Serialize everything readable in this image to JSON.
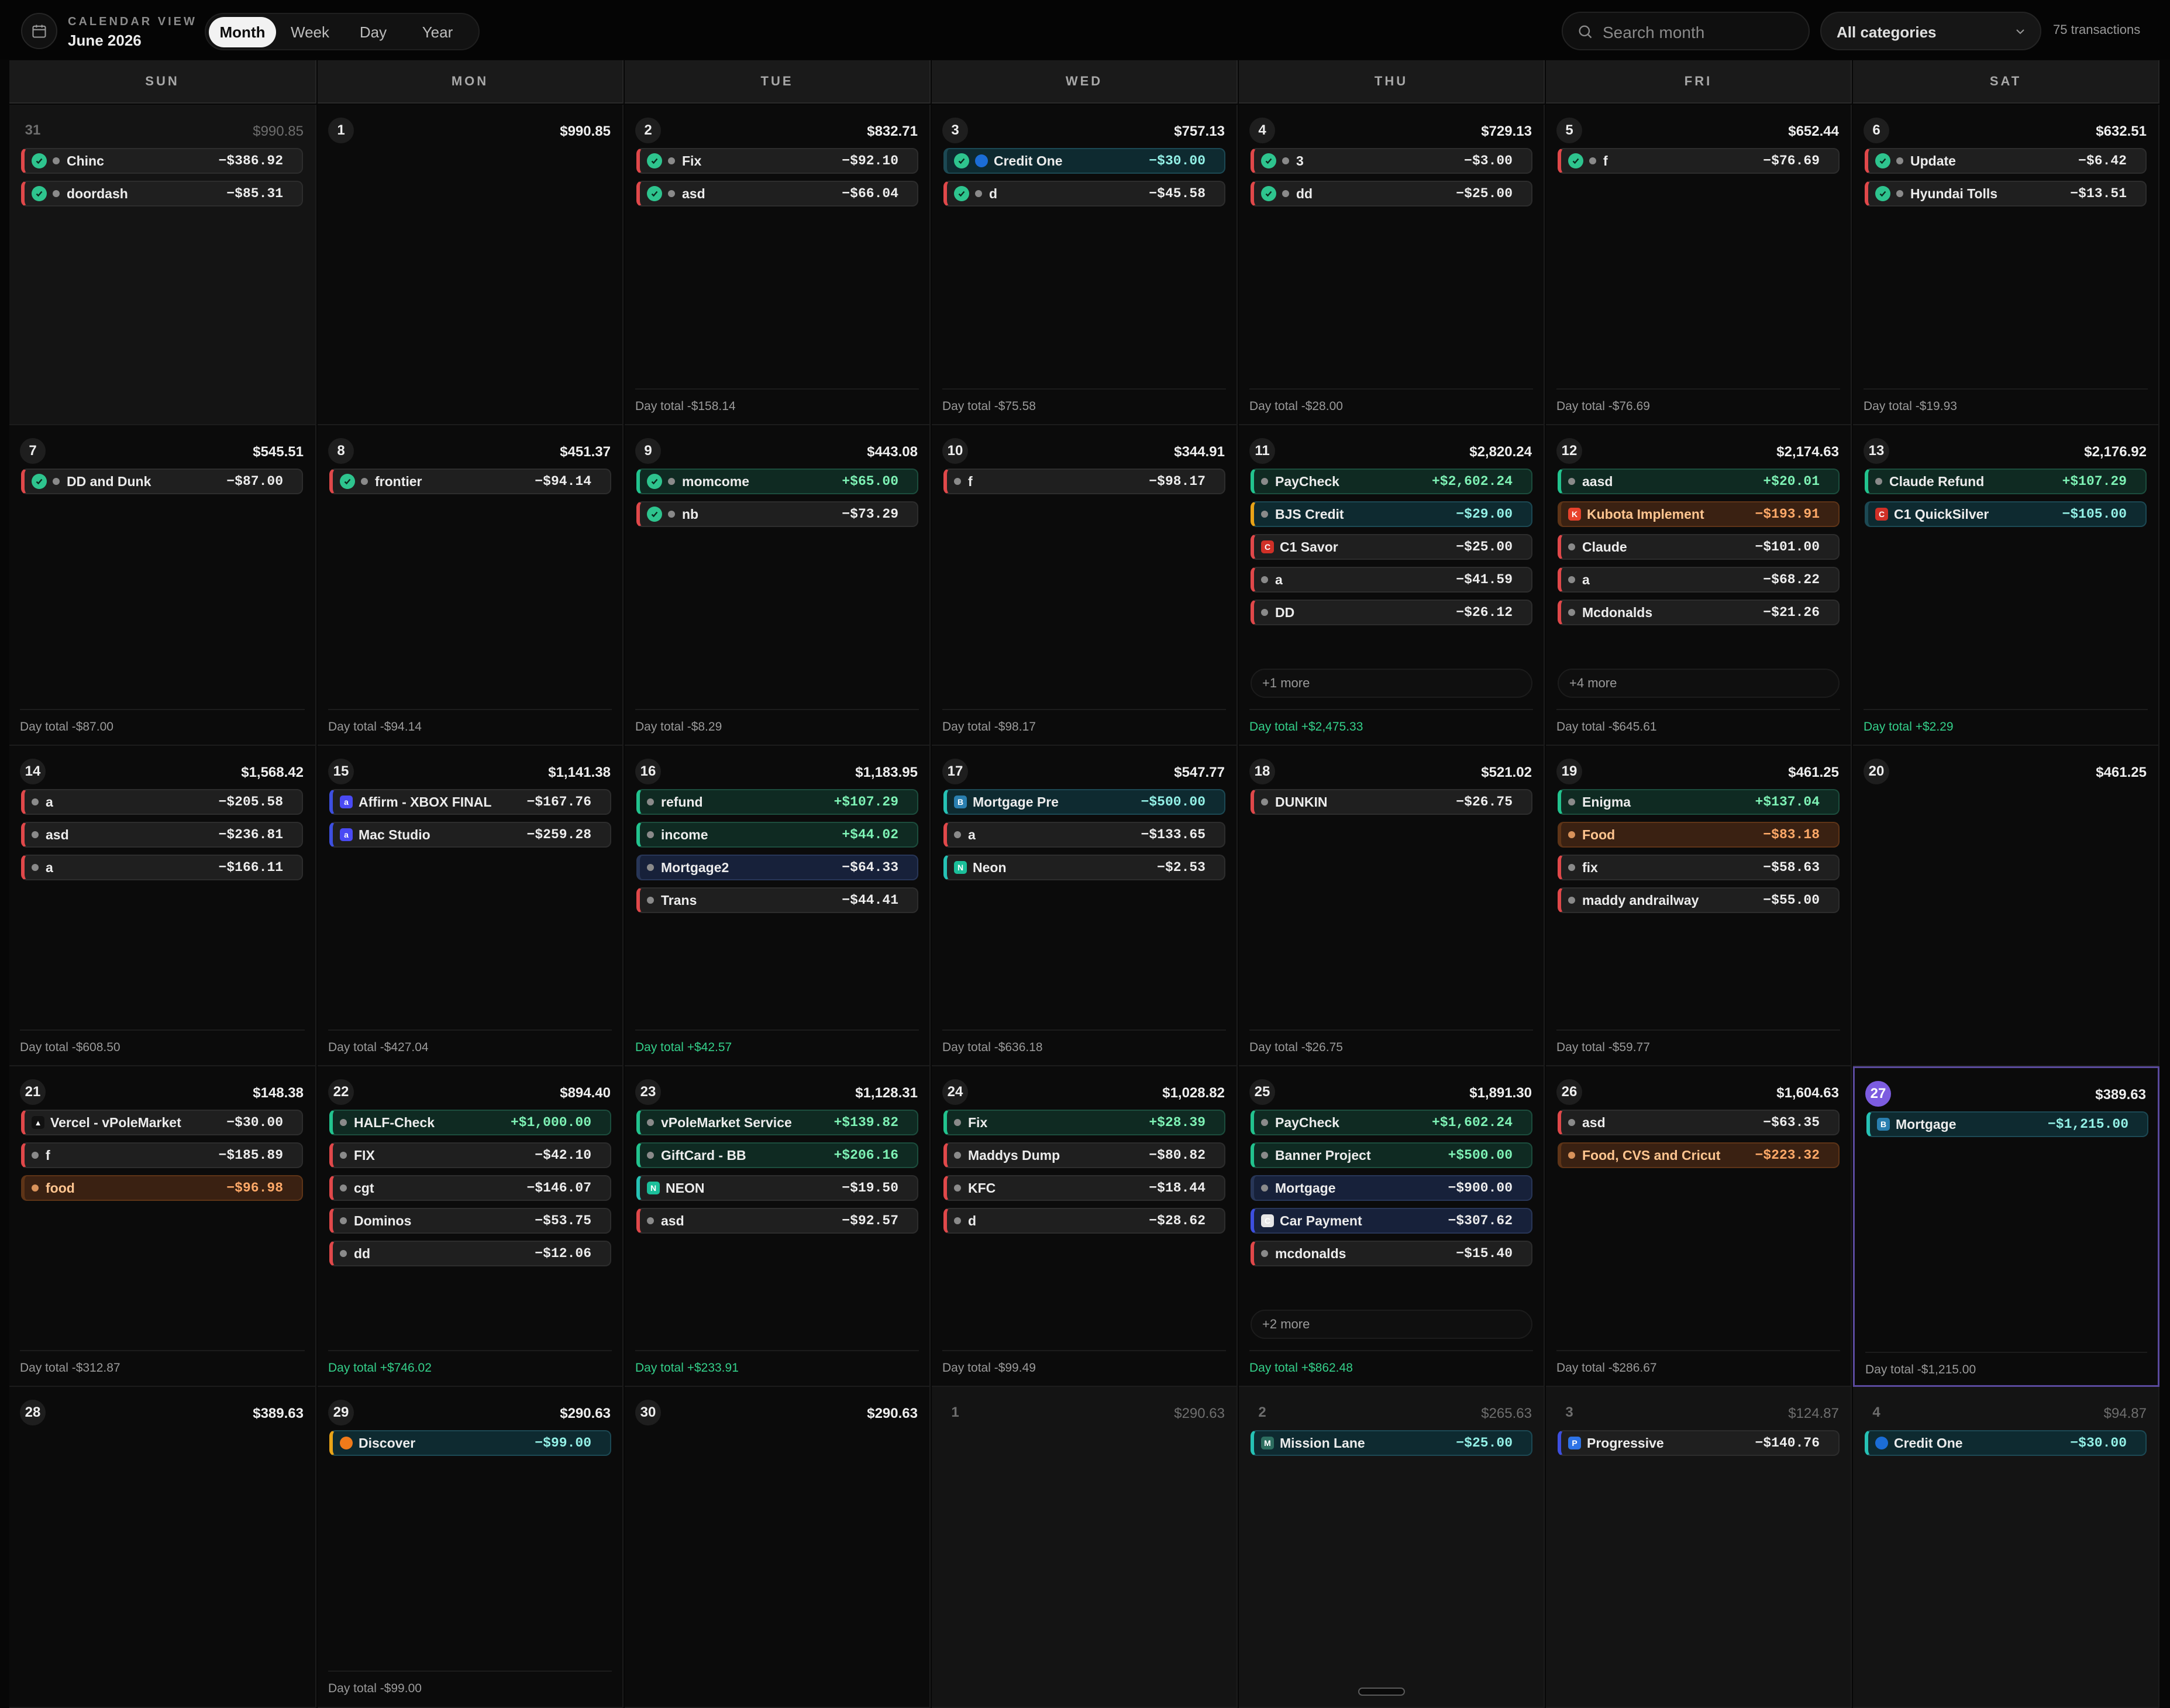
{
  "header": {
    "subtitle": "CALENDAR VIEW",
    "title": "June 2026",
    "view_tabs": [
      "Month",
      "Week",
      "Day",
      "Year"
    ],
    "active_view": "Month",
    "search_placeholder": "Search month",
    "category_filter": "All categories",
    "transaction_count": "75 transactions"
  },
  "colors": {
    "income": "#22c38e",
    "expense": "#e0484a",
    "today": "#7c5ce0",
    "cleared_check": "#2ec48e"
  },
  "weekdays": [
    "SUN",
    "MON",
    "TUE",
    "WED",
    "THU",
    "FRI",
    "SAT"
  ],
  "weeks": [
    [
      {
        "day": "31",
        "balance": "$990.85",
        "dim": true,
        "total": "",
        "tx": [
          {
            "name": "Chinc",
            "amount": "−$386.92",
            "check": true
          },
          {
            "name": "doordash",
            "amount": "−$85.31",
            "check": true
          }
        ]
      },
      {
        "day": "1",
        "balance": "$990.85",
        "total": "",
        "tx": []
      },
      {
        "day": "2",
        "balance": "$832.71",
        "total": "Day total -$158.14",
        "tx": [
          {
            "name": "Fix",
            "amount": "−$92.10",
            "check": true
          },
          {
            "name": "asd",
            "amount": "−$66.04",
            "check": true
          }
        ]
      },
      {
        "day": "3",
        "balance": "$757.13",
        "total": "Day total -$75.58",
        "tx": [
          {
            "name": "Credit One",
            "amount": "−$30.00",
            "check": true,
            "style": "teal",
            "icon": "credit-one-logo",
            "nodot": true
          },
          {
            "name": "d",
            "amount": "−$45.58",
            "check": true
          }
        ]
      },
      {
        "day": "4",
        "balance": "$729.13",
        "total": "Day total -$28.00",
        "tx": [
          {
            "name": "3",
            "amount": "−$3.00",
            "check": true
          },
          {
            "name": "dd",
            "amount": "−$25.00",
            "check": true
          }
        ]
      },
      {
        "day": "5",
        "balance": "$652.44",
        "total": "Day total -$76.69",
        "tx": [
          {
            "name": "f",
            "amount": "−$76.69",
            "check": true
          }
        ]
      },
      {
        "day": "6",
        "balance": "$632.51",
        "total": "Day total -$19.93",
        "tx": [
          {
            "name": "Update",
            "amount": "−$6.42",
            "check": true
          },
          {
            "name": "Hyundai Tolls",
            "amount": "−$13.51",
            "check": true
          }
        ]
      }
    ],
    [
      {
        "day": "7",
        "balance": "$545.51",
        "total": "Day total -$87.00",
        "tx": [
          {
            "name": "DD and Dunk",
            "amount": "−$87.00",
            "check": true
          }
        ]
      },
      {
        "day": "8",
        "balance": "$451.37",
        "total": "Day total -$94.14",
        "tx": [
          {
            "name": "frontier",
            "amount": "−$94.14",
            "check": true
          }
        ]
      },
      {
        "day": "9",
        "balance": "$443.08",
        "total": "Day total -$8.29",
        "tx": [
          {
            "name": "momcome",
            "amount": "+$65.00",
            "check": true,
            "style": "inc"
          },
          {
            "name": "nb",
            "amount": "−$73.29",
            "check": true
          }
        ]
      },
      {
        "day": "10",
        "balance": "$344.91",
        "total": "Day total -$98.17",
        "tx": [
          {
            "name": "f",
            "amount": "−$98.17"
          }
        ]
      },
      {
        "day": "11",
        "balance": "$2,820.24",
        "total": "Day total +$2,475.33",
        "pos": true,
        "more": "+1 more",
        "tx": [
          {
            "name": "PayCheck",
            "amount": "+$2,602.24",
            "style": "inc"
          },
          {
            "name": "BJS Credit",
            "amount": "−$29.00",
            "style": "teal",
            "border": "yellowb"
          },
          {
            "name": "C1 Savor",
            "amount": "−$25.00",
            "icon": "capital-one-logo",
            "nodot": true
          },
          {
            "name": "a",
            "amount": "−$41.59"
          },
          {
            "name": "DD",
            "amount": "−$26.12"
          }
        ]
      },
      {
        "day": "12",
        "balance": "$2,174.63",
        "total": "Day total -$645.61",
        "more": "+4 more",
        "tx": [
          {
            "name": "aasd",
            "amount": "+$20.01",
            "style": "inc"
          },
          {
            "name": "Kubota Implement",
            "amount": "−$193.91",
            "style": "orange",
            "icon": "kubota-logo",
            "nodot": true
          },
          {
            "name": "Claude",
            "amount": "−$101.00"
          },
          {
            "name": "a",
            "amount": "−$68.22"
          },
          {
            "name": "Mcdonalds",
            "amount": "−$21.26"
          }
        ]
      },
      {
        "day": "13",
        "balance": "$2,176.92",
        "total": "Day total +$2.29",
        "pos": true,
        "tx": [
          {
            "name": "Claude Refund",
            "amount": "+$107.29",
            "style": "inc"
          },
          {
            "name": "C1 QuickSilver",
            "amount": "−$105.00",
            "style": "teal",
            "icon": "capital-one-logo",
            "nodot": true
          }
        ]
      }
    ],
    [
      {
        "day": "14",
        "balance": "$1,568.42",
        "total": "Day total -$608.50",
        "tx": [
          {
            "name": "a",
            "amount": "−$205.58"
          },
          {
            "name": "asd",
            "amount": "−$236.81"
          },
          {
            "name": "a",
            "amount": "−$166.11"
          }
        ]
      },
      {
        "day": "15",
        "balance": "$1,141.38",
        "total": "Day total -$427.04",
        "tx": [
          {
            "name": "Affirm - XBOX FINAL",
            "amount": "−$167.76",
            "border": "blueb",
            "icon": "affirm-logo",
            "nodot": true
          },
          {
            "name": "Mac Studio",
            "amount": "−$259.28",
            "border": "blueb",
            "icon": "affirm-logo",
            "nodot": true
          }
        ]
      },
      {
        "day": "16",
        "balance": "$1,183.95",
        "total": "Day total +$42.57",
        "pos": true,
        "tx": [
          {
            "name": "refund",
            "amount": "+$107.29",
            "style": "inc"
          },
          {
            "name": "income",
            "amount": "+$44.02",
            "style": "inc"
          },
          {
            "name": "Mortgage2",
            "amount": "−$64.33",
            "style": "navy"
          },
          {
            "name": "Trans",
            "amount": "−$44.41"
          }
        ]
      },
      {
        "day": "17",
        "balance": "$547.77",
        "total": "Day total -$636.18",
        "tx": [
          {
            "name": "Mortgage Pre",
            "amount": "−$500.00",
            "style": "teal",
            "border": "tealb",
            "icon": "bank-logo",
            "nodot": true
          },
          {
            "name": "a",
            "amount": "−$133.65"
          },
          {
            "name": "Neon",
            "amount": "−$2.53",
            "border": "tealb",
            "icon": "neon-logo",
            "nodot": true
          }
        ]
      },
      {
        "day": "18",
        "balance": "$521.02",
        "total": "Day total -$26.75",
        "tx": [
          {
            "name": "DUNKIN",
            "amount": "−$26.75"
          }
        ]
      },
      {
        "day": "19",
        "balance": "$461.25",
        "total": "Day total -$59.77",
        "tx": [
          {
            "name": "Enigma",
            "amount": "+$137.04",
            "style": "inc"
          },
          {
            "name": "Food",
            "amount": "−$83.18",
            "style": "orange"
          },
          {
            "name": "fix",
            "amount": "−$58.63"
          },
          {
            "name": "maddy andrailway",
            "amount": "−$55.00"
          }
        ]
      },
      {
        "day": "20",
        "balance": "$461.25",
        "total": "",
        "tx": []
      }
    ],
    [
      {
        "day": "21",
        "balance": "$148.38",
        "total": "Day total -$312.87",
        "tx": [
          {
            "name": "Vercel - vPoleMarket",
            "amount": "−$30.00",
            "icon": "vercel-logo",
            "nodot": true
          },
          {
            "name": "f",
            "amount": "−$185.89"
          },
          {
            "name": "food",
            "amount": "−$96.98",
            "style": "orange"
          }
        ]
      },
      {
        "day": "22",
        "balance": "$894.40",
        "total": "Day total +$746.02",
        "pos": true,
        "tx": [
          {
            "name": "HALF-Check",
            "amount": "+$1,000.00",
            "style": "inc"
          },
          {
            "name": "FIX",
            "amount": "−$42.10"
          },
          {
            "name": "cgt",
            "amount": "−$146.07"
          },
          {
            "name": "Dominos",
            "amount": "−$53.75"
          },
          {
            "name": "dd",
            "amount": "−$12.06"
          }
        ]
      },
      {
        "day": "23",
        "balance": "$1,128.31",
        "total": "Day total +$233.91",
        "pos": true,
        "tx": [
          {
            "name": "vPoleMarket Service",
            "amount": "+$139.82",
            "style": "inc"
          },
          {
            "name": "GiftCard - BB",
            "amount": "+$206.16",
            "style": "inc"
          },
          {
            "name": "NEON",
            "amount": "−$19.50",
            "border": "tealb",
            "icon": "neon-logo",
            "nodot": true
          },
          {
            "name": "asd",
            "amount": "−$92.57"
          }
        ]
      },
      {
        "day": "24",
        "balance": "$1,028.82",
        "total": "Day total -$99.49",
        "tx": [
          {
            "name": "Fix",
            "amount": "+$28.39",
            "style": "inc"
          },
          {
            "name": "Maddys Dump",
            "amount": "−$80.82"
          },
          {
            "name": "KFC",
            "amount": "−$18.44"
          },
          {
            "name": "d",
            "amount": "−$28.62"
          }
        ]
      },
      {
        "day": "25",
        "balance": "$1,891.30",
        "total": "Day total +$862.48",
        "pos": true,
        "more": "+2 more",
        "tx": [
          {
            "name": "PayCheck",
            "amount": "+$1,602.24",
            "style": "inc"
          },
          {
            "name": "Banner Project",
            "amount": "+$500.00",
            "style": "inc"
          },
          {
            "name": "Mortgage",
            "amount": "−$900.00",
            "style": "navy"
          },
          {
            "name": "Car Payment",
            "amount": "−$307.62",
            "style": "navy",
            "border": "blueb",
            "icon": "car-logo",
            "nodot": true
          },
          {
            "name": "mcdonalds",
            "amount": "−$15.40"
          }
        ]
      },
      {
        "day": "26",
        "balance": "$1,604.63",
        "total": "Day total -$286.67",
        "tx": [
          {
            "name": "asd",
            "amount": "−$63.35"
          },
          {
            "name": "Food, CVS and Cricut",
            "amount": "−$223.32",
            "style": "orange"
          }
        ]
      },
      {
        "day": "27",
        "balance": "$389.63",
        "today": true,
        "total": "Day total -$1,215.00",
        "tx": [
          {
            "name": "Mortgage",
            "amount": "−$1,215.00",
            "style": "teal",
            "border": "tealb",
            "icon": "bank-logo",
            "nodot": true
          }
        ]
      }
    ],
    [
      {
        "day": "28",
        "balance": "$389.63",
        "total": "",
        "tx": []
      },
      {
        "day": "29",
        "balance": "$290.63",
        "total": "Day total -$99.00",
        "tx": [
          {
            "name": "Discover",
            "amount": "−$99.00",
            "style": "teal",
            "border": "yellowb",
            "icon": "discover-logo",
            "nodot": true
          }
        ]
      },
      {
        "day": "30",
        "balance": "$290.63",
        "total": "",
        "tx": []
      },
      {
        "day": "1",
        "balance": "$290.63",
        "dim": true,
        "total": "",
        "tx": []
      },
      {
        "day": "2",
        "balance": "$265.63",
        "dim": true,
        "total": "",
        "tx": [
          {
            "name": "Mission Lane",
            "amount": "−$25.00",
            "style": "teal",
            "border": "tealb",
            "icon": "mission-lane-logo",
            "nodot": true
          }
        ]
      },
      {
        "day": "3",
        "balance": "$124.87",
        "dim": true,
        "total": "",
        "tx": [
          {
            "name": "Progressive",
            "amount": "−$140.76",
            "border": "blueb",
            "icon": "progressive-logo",
            "nodot": true
          }
        ]
      },
      {
        "day": "4",
        "balance": "$94.87",
        "dim": true,
        "total": "",
        "tx": [
          {
            "name": "Credit One",
            "amount": "−$30.00",
            "style": "teal",
            "border": "tealb",
            "icon": "credit-one-logo",
            "nodot": true
          }
        ]
      }
    ]
  ]
}
